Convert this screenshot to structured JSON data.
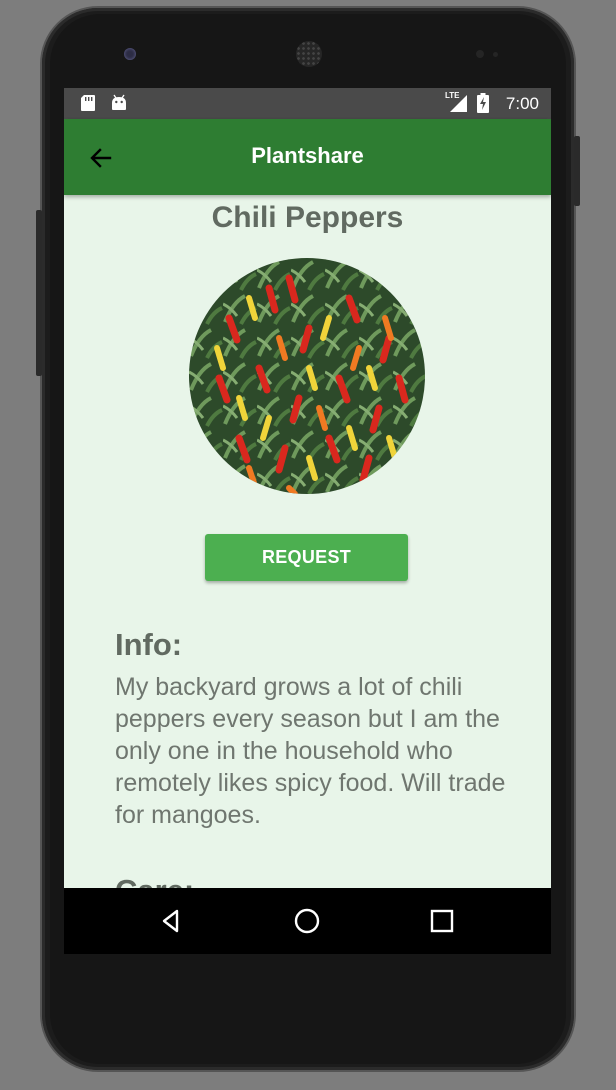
{
  "status_bar": {
    "time": "7:00",
    "network": "LTE",
    "left_icons": [
      "sd-card-icon",
      "android-icon"
    ],
    "right_icons": [
      "signal-icon",
      "battery-charging-icon"
    ]
  },
  "app_bar": {
    "title": "Plantshare",
    "back_icon": "arrow-back-icon",
    "color": "#2e7d32"
  },
  "plant": {
    "name": "Chili Peppers",
    "photo_icon": "chili-pepper-photo"
  },
  "actions": {
    "request_label": "REQUEST",
    "request_color": "#4caf50"
  },
  "info": {
    "heading": "Info:",
    "body": "My backyard grows a lot of chili peppers every season but I am the only one in the household who remotely likes spicy food. Will trade for mangoes."
  },
  "care": {
    "heading": "Care:"
  },
  "nav_bar": {
    "icons": [
      "back-triangle-icon",
      "home-circle-icon",
      "recents-square-icon"
    ]
  },
  "colors": {
    "background": "#e8f5e9",
    "text": "#616a61"
  }
}
